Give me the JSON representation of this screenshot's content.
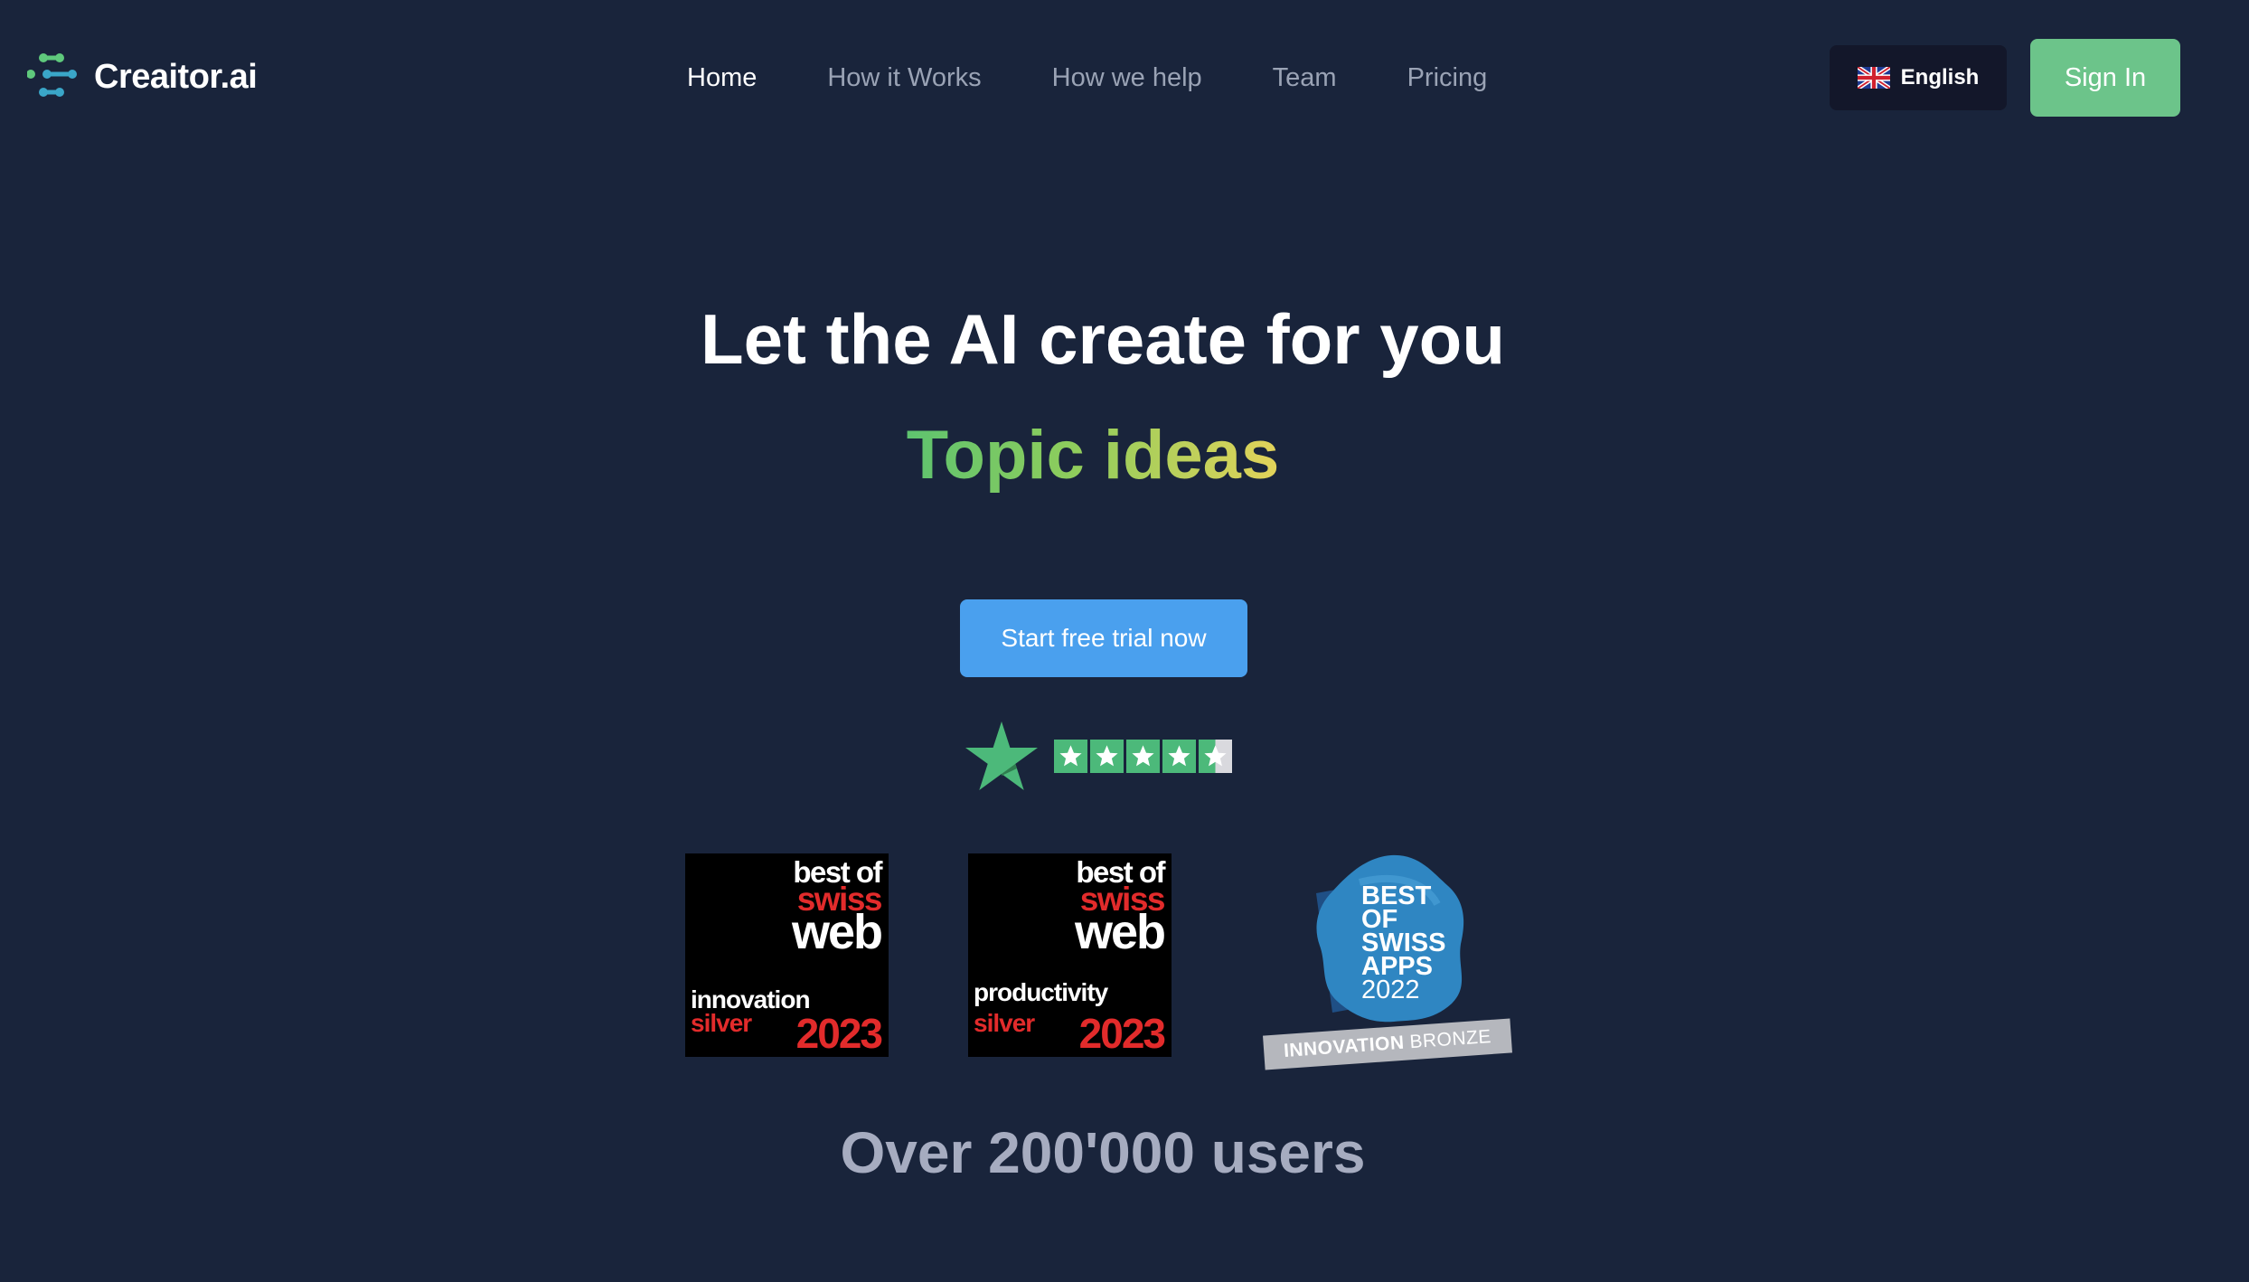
{
  "header": {
    "logo_text": "Creaitor.ai",
    "nav": [
      {
        "label": "Home",
        "active": true
      },
      {
        "label": "How it Works",
        "active": false
      },
      {
        "label": "How we help",
        "active": false
      },
      {
        "label": "Team",
        "active": false
      },
      {
        "label": "Pricing",
        "active": false
      }
    ],
    "language": {
      "label": "English",
      "icon": "uk-flag-icon"
    },
    "sign_in_label": "Sign In"
  },
  "hero": {
    "title": "Let the AI create for you",
    "rotating_text": "Topic ideas",
    "cta_label": "Start free trial now"
  },
  "rating": {
    "icon": "trustpilot-star-icon",
    "stars_total": 5,
    "stars_value": 4.5
  },
  "awards": [
    {
      "line1": "best of",
      "line2": "swiss",
      "line3": "web",
      "category": "innovation",
      "level": "silver",
      "year": "2023"
    },
    {
      "line1": "best of",
      "line2": "swiss",
      "line3": "web",
      "category": "productivity",
      "level": "silver",
      "year": "2023"
    },
    {
      "lines": [
        "BEST",
        "OF",
        "SWISS",
        "APPS"
      ],
      "year": "2022",
      "ribbon_bold": "INNOVATION",
      "ribbon_light": "BRONZE"
    }
  ],
  "stats": {
    "users_text": "Over 200'000 users"
  },
  "colors": {
    "background": "#19243b",
    "sign_in": "#6cc48a",
    "cta": "#4aa0ee",
    "gradient_start": "#5ec36f",
    "gradient_end": "#e3d35a",
    "trustpilot": "#4cb97a"
  }
}
